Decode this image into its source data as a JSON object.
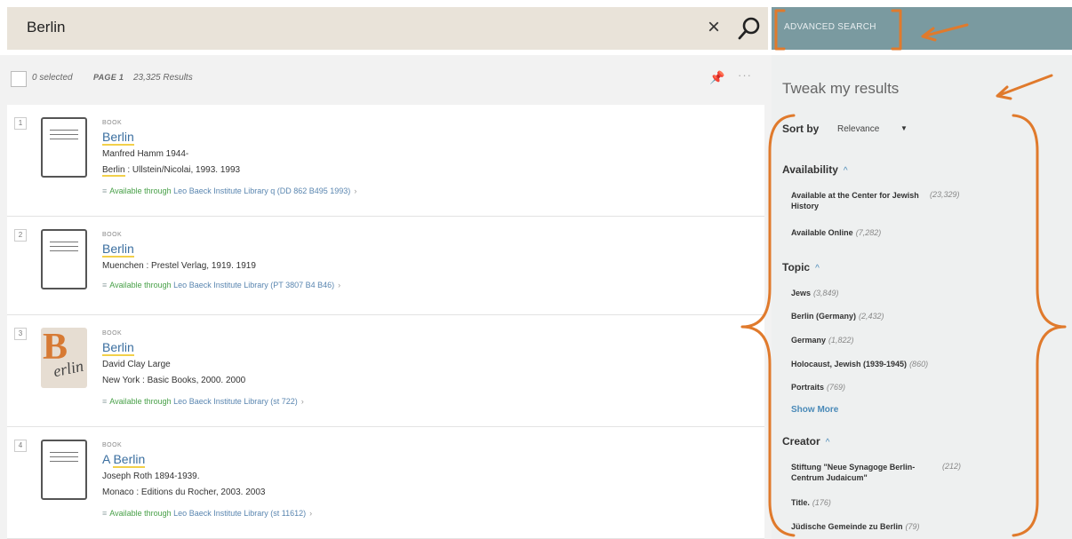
{
  "search": {
    "query": "Berlin"
  },
  "advanced_search_label": "ADVANCED SEARCH",
  "results_header": {
    "selected": "0 selected",
    "page": "PAGE 1",
    "count": "23,325 Results",
    "more": "···"
  },
  "results": [
    {
      "num": "1",
      "type": "BOOK",
      "title_prefix": "",
      "title": "Berlin",
      "line2": "Manfred Hamm 1944-",
      "line3_hl": "Berlin",
      "line3_rest": " : Ullstein/Nicolai, 1993. 1993",
      "avail": "Available through",
      "library": "Leo Baeck Institute Library",
      "callno": "q (DD 862 B495 1993)"
    },
    {
      "num": "2",
      "type": "BOOK",
      "title_prefix": "",
      "title": "Berlin",
      "line2": "Muenchen : Prestel Verlag, 1919. 1919",
      "line3_hl": "",
      "line3_rest": "",
      "avail": "Available through",
      "library": "Leo Baeck Institute Library",
      "callno": "(PT 3807 B4 B46)"
    },
    {
      "num": "3",
      "type": "BOOK",
      "title_prefix": "",
      "title": "Berlin",
      "line2": "David Clay Large",
      "line3_hl": "",
      "line3_rest": "New York : Basic Books, 2000. 2000",
      "avail": "Available through",
      "library": "Leo Baeck Institute Library",
      "callno": "(st 722)",
      "cover_big": "B",
      "cover_small": "erlin"
    },
    {
      "num": "4",
      "type": "BOOK",
      "title_prefix": "A ",
      "title": "Berlin",
      "line2": "Joseph Roth 1894-1939.",
      "line3_hl": "",
      "line3_rest": "Monaco : Editions du Rocher, 2003. 2003",
      "avail": "Available through",
      "library": "Leo Baeck Institute Library",
      "callno": "(st 11612)"
    }
  ],
  "sidebar": {
    "heading": "Tweak my results",
    "sort_label": "Sort by",
    "sort_value": "Relevance",
    "facets": [
      {
        "name": "Availability",
        "items": [
          {
            "label": "Available at the Center for Jewish History",
            "count": "(23,329)"
          },
          {
            "label": "Available Online",
            "count": "(7,282)"
          }
        ]
      },
      {
        "name": "Topic",
        "items": [
          {
            "label": "Jews",
            "count": "(3,849)"
          },
          {
            "label": "Berlin (Germany)",
            "count": "(2,432)"
          },
          {
            "label": "Germany",
            "count": "(1,822)"
          },
          {
            "label": "Holocaust, Jewish (1939-1945)",
            "count": "(860)"
          },
          {
            "label": "Portraits",
            "count": "(769)"
          }
        ],
        "show_more": "Show More"
      },
      {
        "name": "Creator",
        "items": [
          {
            "label": "Stiftung \"Neue Synagoge Berlin-Centrum Judaicum\"",
            "count": "(212)"
          },
          {
            "label": "Title.",
            "count": "(176)"
          },
          {
            "label": "Jüdische Gemeinde zu Berlin",
            "count": "(79)"
          }
        ]
      }
    ]
  },
  "colors": {
    "annotation": "#e07a2c",
    "link": "#3b6fa0",
    "available": "#48a048",
    "search_bg": "#e9e3d9",
    "advanced_bg": "#7a9aa0"
  },
  "icons": {
    "clear": "close-icon",
    "search": "search-icon",
    "pin": "pin-icon",
    "more": "more-icon",
    "expand": "chevron-up-icon"
  }
}
